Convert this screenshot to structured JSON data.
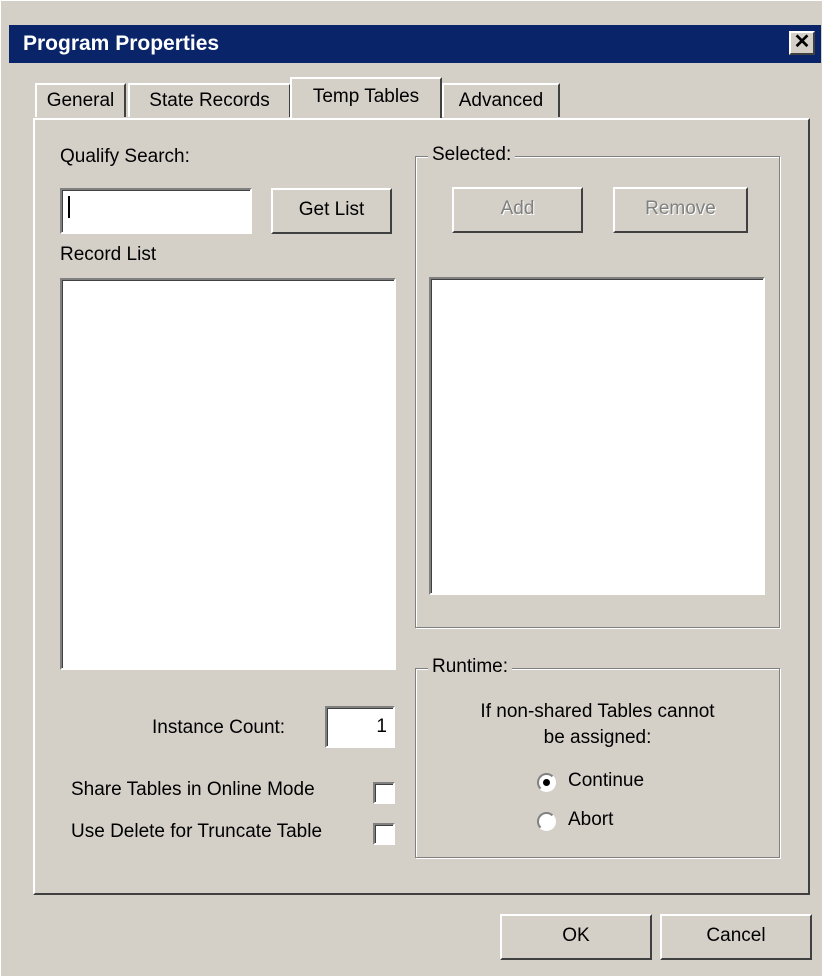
{
  "window": {
    "title": "Program Properties",
    "close_glyph": "✕"
  },
  "tabs": [
    {
      "label": "General",
      "active": false
    },
    {
      "label": "State Records",
      "active": false
    },
    {
      "label": "Temp Tables",
      "active": true
    },
    {
      "label": "Advanced",
      "active": false
    }
  ],
  "left": {
    "qualify_label": "Qualify Search:",
    "search_value": "",
    "get_list_label": "Get List",
    "record_list_label": "Record List",
    "instance_count_label": "Instance Count:",
    "instance_count_value": "1",
    "share_tables_label": "Share Tables in Online Mode",
    "share_tables_checked": false,
    "use_delete_label": "Use Delete for Truncate Table",
    "use_delete_checked": false
  },
  "selected": {
    "group_label": "Selected:",
    "add_label": "Add",
    "remove_label": "Remove"
  },
  "runtime": {
    "group_label": "Runtime:",
    "message_line1": "If non-shared Tables cannot",
    "message_line2": "be assigned:",
    "options": [
      {
        "label": "Continue",
        "selected": true
      },
      {
        "label": "Abort",
        "selected": false
      }
    ]
  },
  "footer": {
    "ok_label": "OK",
    "cancel_label": "Cancel"
  },
  "colors": {
    "title_bar": "#0a246a",
    "dialog_face": "#d4d0c8",
    "disabled_text": "#808080"
  },
  "icons": {
    "close": "close-icon",
    "caret": "text-caret",
    "radio_selected": "radio-dot"
  }
}
